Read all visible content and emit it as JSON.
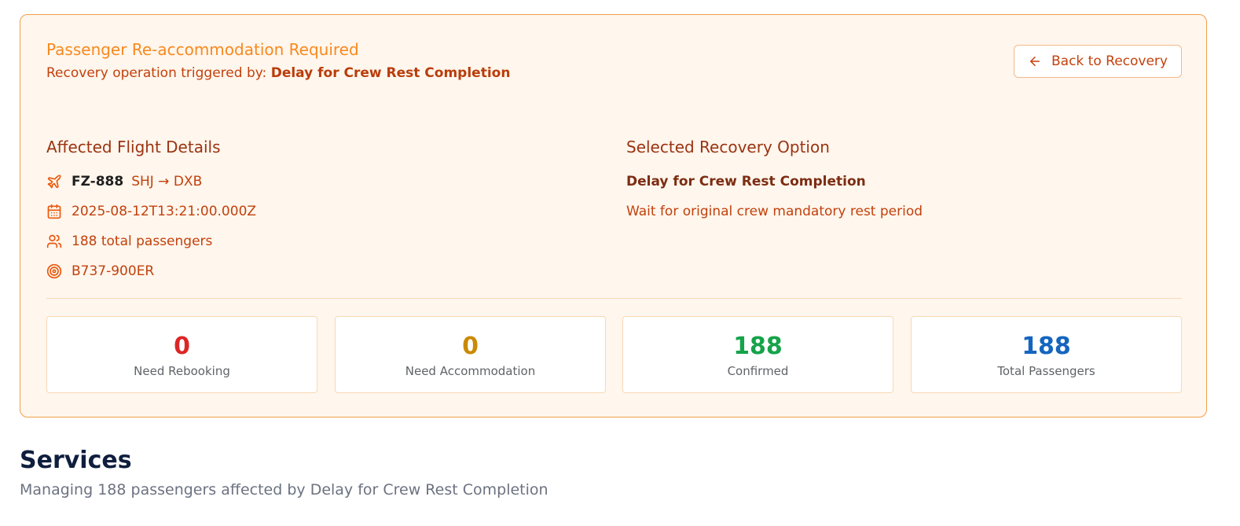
{
  "alert": {
    "title": "Passenger Re-accommodation Required",
    "trigger_prefix": "Recovery operation triggered by: ",
    "trigger_name": "Delay for Crew Rest Completion",
    "back_button": {
      "label": "Back to Recovery",
      "icon": "arrow-left-icon"
    }
  },
  "flight_details": {
    "heading": "Affected Flight Details",
    "flight_number": "FZ-888",
    "route": "SHJ → DXB",
    "datetime": "2025-08-12T13:21:00.000Z",
    "passengers": "188 total passengers",
    "aircraft": "B737-900ER",
    "icons": {
      "flight": "plane-icon",
      "date": "calendar-icon",
      "passengers": "users-icon",
      "aircraft": "target-icon"
    }
  },
  "recovery_option": {
    "heading": "Selected Recovery Option",
    "name": "Delay for Crew Rest Completion",
    "description": "Wait for original crew mandatory rest period"
  },
  "stats": [
    {
      "value": "0",
      "label": "Need Rebooking",
      "color": "#dc2626"
    },
    {
      "value": "0",
      "label": "Need Accommodation",
      "color": "#ca8a04"
    },
    {
      "value": "188",
      "label": "Confirmed",
      "color": "#16a34a"
    },
    {
      "value": "188",
      "label": "Total Passengers",
      "color": "#1565c0"
    }
  ],
  "services": {
    "title": "Services",
    "subtitle": "Managing 188 passengers affected by Delay for Crew Rest Completion"
  },
  "colors": {
    "accent": "#f7891e",
    "card_background": "#fff6ed",
    "card_border": "#f0a04b",
    "text_primary": "#c2410c"
  }
}
